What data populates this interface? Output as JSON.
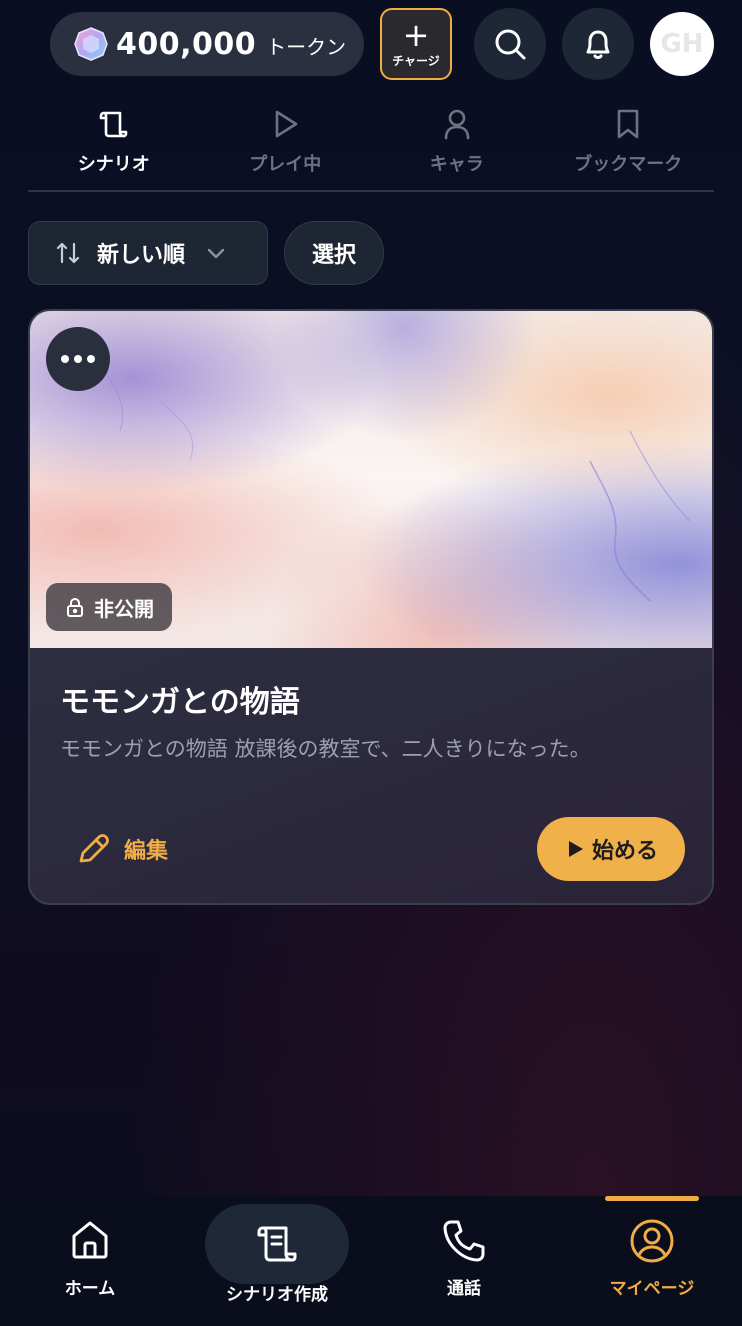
{
  "header": {
    "token_amount": "400,000",
    "token_unit": "トークン",
    "charge_plus": "+",
    "charge_label": "チャージ",
    "avatar_initials": "GH"
  },
  "tabs": [
    {
      "label": "シナリオ",
      "icon": "scroll-icon",
      "active": true
    },
    {
      "label": "プレイ中",
      "icon": "play-icon",
      "active": false
    },
    {
      "label": "キャラ",
      "icon": "user-icon",
      "active": false
    },
    {
      "label": "ブックマーク",
      "icon": "bookmark-icon",
      "active": false
    }
  ],
  "filters": {
    "sort_label": "新しい順",
    "select_label": "選択"
  },
  "card": {
    "visibility_label": "非公開",
    "title": "モモンガとの物語",
    "description": "モモンガとの物語 放課後の教室で、二人きりになった。",
    "edit_label": "編集",
    "start_label": "始める"
  },
  "bottom_nav": [
    {
      "label": "ホーム",
      "icon": "home-icon",
      "active": false
    },
    {
      "label": "シナリオ作成",
      "icon": "scroll-icon",
      "active": false
    },
    {
      "label": "通話",
      "icon": "phone-icon",
      "active": false
    },
    {
      "label": "マイページ",
      "icon": "profile-icon",
      "active": true
    }
  ],
  "colors": {
    "accent": "#f0ad45",
    "background": "#0c1026",
    "muted_text": "#6d7383"
  }
}
